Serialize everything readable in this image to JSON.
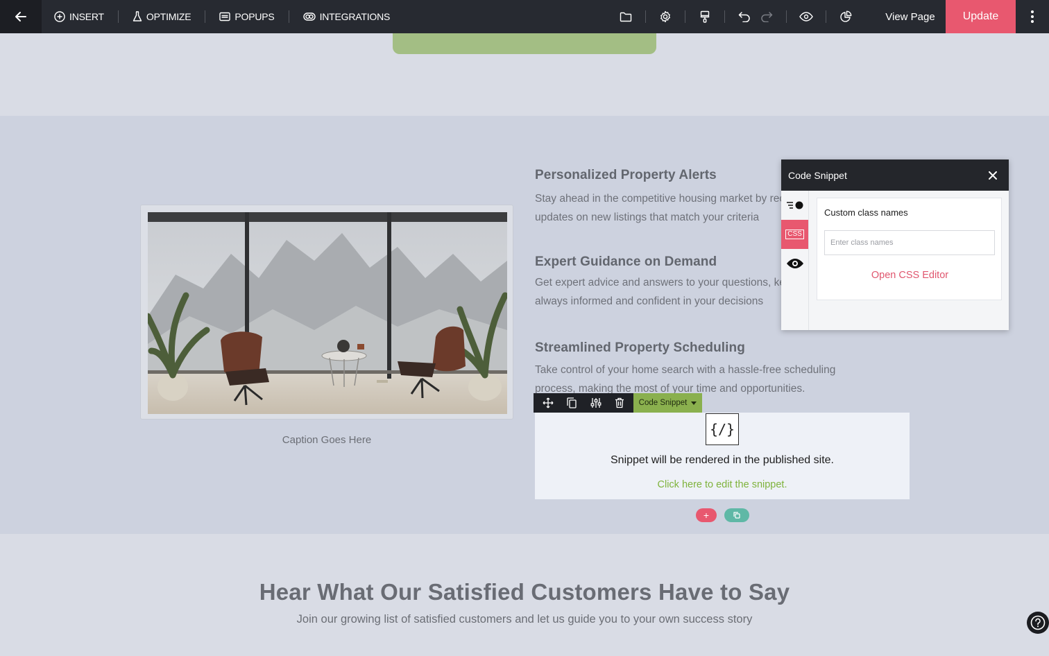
{
  "topbar": {
    "menu": [
      {
        "label": "INSERT",
        "icon": "plus-circle-icon"
      },
      {
        "label": "OPTIMIZE",
        "icon": "flask-icon"
      },
      {
        "label": "POPUPS",
        "icon": "window-icon"
      },
      {
        "label": "INTEGRATIONS",
        "icon": "link-icon"
      }
    ],
    "view_page": "View Page",
    "update": "Update"
  },
  "features": [
    {
      "title": "Personalized Property Alerts",
      "lines": [
        "Stay ahead in the competitive housing market by receiving",
        "updates on new listings that match your criteria"
      ]
    },
    {
      "title": "Expert Guidance on Demand",
      "lines": [
        "Get expert advice and answers to your questions, keeping you",
        "always informed and confident in your decisions"
      ]
    },
    {
      "title": "Streamlined Property Scheduling",
      "lines": [
        "Take control of your home search with a hassle-free scheduling",
        "process, making the most of your time and opportunities."
      ]
    }
  ],
  "caption": "Caption Goes Here",
  "snippet": {
    "label": "Code Snippet",
    "icon_text": "{/}",
    "message": "Snippet will be rendered in the published site.",
    "edit_link": "Click here to edit the snippet."
  },
  "bottom": {
    "title": "Hear What Our Satisfied Customers Have to Say",
    "subtitle": "Join our growing list of satisfied customers and let us guide you to your own success story"
  },
  "panel": {
    "title": "Code Snippet",
    "css_tab": "CSS",
    "field_label": "Custom class names",
    "field_placeholder": "Enter class names",
    "field_value": "",
    "editor_link": "Open CSS Editor"
  },
  "colors": {
    "accent": "#e8586f",
    "snippet_green": "#8ab04e",
    "link_green": "#7fb33c",
    "topbar": "#272a31"
  }
}
